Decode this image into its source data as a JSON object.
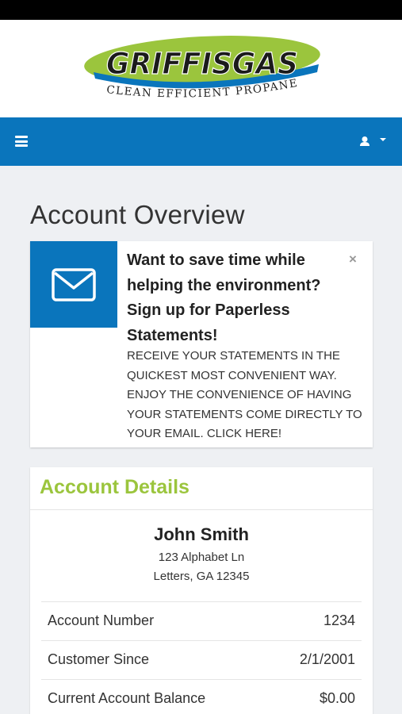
{
  "brand": {
    "logo_text": "GRIFFISGAS",
    "tagline": "CLEAN EFFICIENT PROPANE",
    "green": "#9bc53d",
    "blue": "#0a75bc"
  },
  "navbar": {
    "menu_icon": "hamburger-menu-icon",
    "user_icon": "user-icon",
    "user_dropdown_icon": "caret-down-icon"
  },
  "page": {
    "title": "Account Overview"
  },
  "promo": {
    "icon": "envelope-icon",
    "heading": "Want to save time while helping the environment? Sign up for Paperless Statements!",
    "body": "Receive your statements in the quickest most convenient way. Enjoy the convenience of having your statements come directly to your email. Click here!",
    "close_label": "×"
  },
  "account_details": {
    "title": "Account Details",
    "name": "John Smith",
    "address_line1": "123 Alphabet Ln",
    "address_line2": "Letters, GA 12345",
    "rows": [
      {
        "label": "Account Number",
        "value": "1234"
      },
      {
        "label": "Customer Since",
        "value": "2/1/2001"
      },
      {
        "label": "Current Account Balance",
        "value": "$0.00"
      }
    ]
  }
}
